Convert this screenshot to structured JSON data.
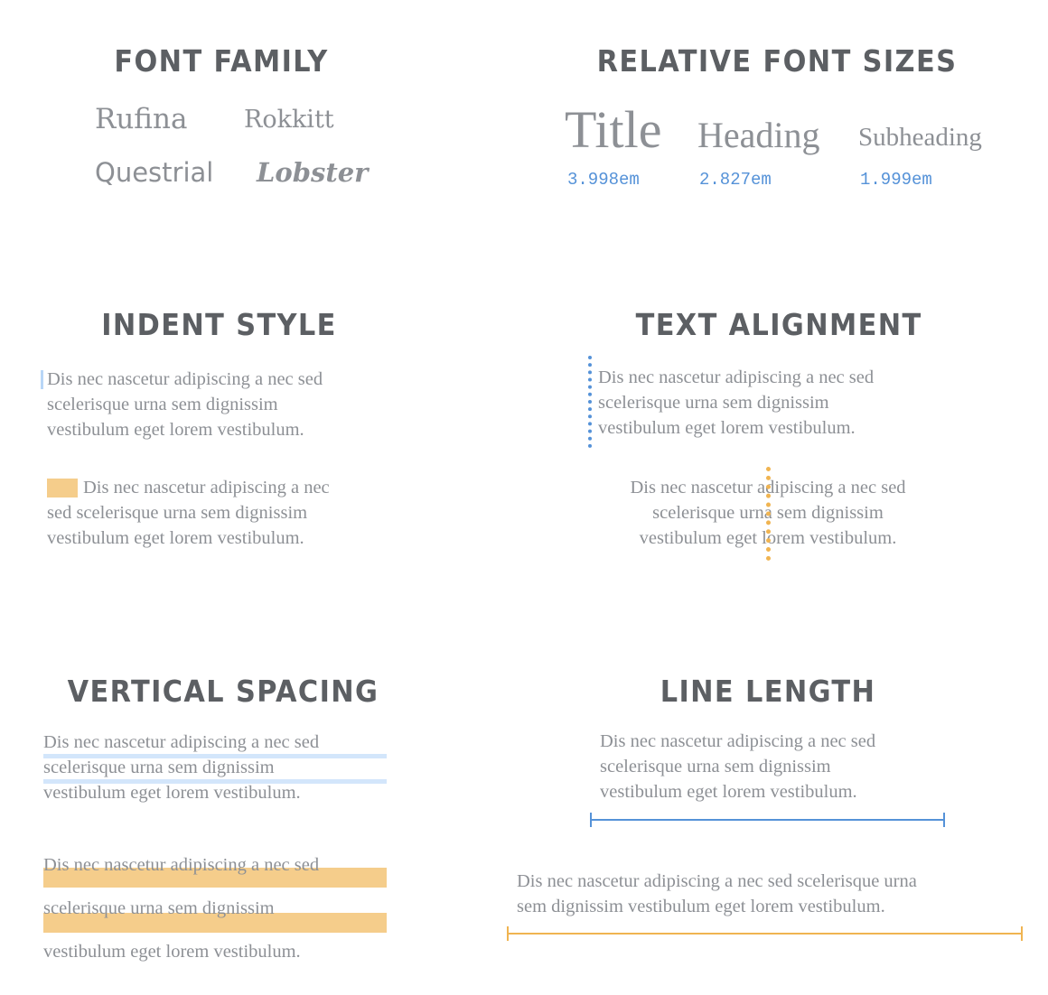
{
  "colors": {
    "heading": "#5c5f63",
    "text": "#8d9095",
    "blue": "#5592d8",
    "light_blue": "#d3e6fb",
    "orange": "#f5cd8b",
    "orange_dot": "#f0b451"
  },
  "font_family": {
    "title": "Font Family",
    "samples": [
      "Rufina",
      "Rokkitt",
      "Questrial",
      "Lobster"
    ]
  },
  "relative_sizes": {
    "title": "Relative Font Sizes",
    "items": [
      {
        "label": "Title",
        "value": "3.998em"
      },
      {
        "label": "Heading",
        "value": "2.827em"
      },
      {
        "label": "Subheading",
        "value": "1.999em"
      }
    ]
  },
  "indent_style": {
    "title": "Indent Style",
    "para1": [
      "Dis nec nascetur adipiscing a nec sed",
      "scelerisque urna sem dignissim",
      "vestibulum eget lorem vestibulum."
    ],
    "para2": [
      "Dis nec nascetur adipiscing a nec",
      "sed scelerisque urna sem dignissim",
      "vestibulum eget lorem vestibulum."
    ]
  },
  "text_alignment": {
    "title": "Text Alignment",
    "para1": [
      "Dis nec nascetur adipiscing a nec sed",
      "scelerisque urna sem dignissim",
      "vestibulum eget lorem vestibulum."
    ],
    "para2": [
      "Dis nec nascetur adipiscing a nec sed",
      "scelerisque urna sem dignissim",
      "vestibulum eget lorem vestibulum."
    ]
  },
  "vertical_spacing": {
    "title": "Vertical Spacing",
    "para1": [
      "Dis nec nascetur adipiscing a nec sed",
      "scelerisque urna sem dignissim",
      "vestibulum eget lorem vestibulum."
    ],
    "para2": [
      "Dis nec nascetur adipiscing a nec sed",
      "scelerisque urna sem dignissim",
      "vestibulum eget lorem vestibulum."
    ]
  },
  "line_length": {
    "title": "Line Length",
    "para1": [
      "Dis nec nascetur adipiscing a nec sed",
      "scelerisque urna sem dignissim",
      "vestibulum eget lorem vestibulum."
    ],
    "para2": [
      "Dis nec nascetur adipiscing a nec sed scelerisque urna",
      "sem dignissim vestibulum eget lorem vestibulum."
    ]
  }
}
